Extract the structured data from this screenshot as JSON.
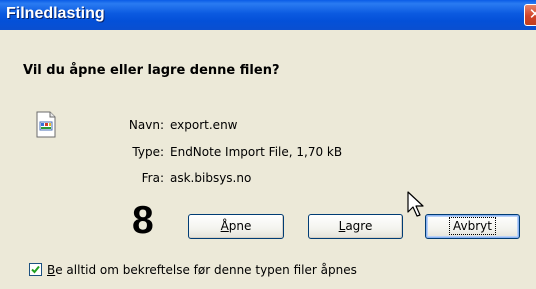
{
  "window": {
    "title": "Filnedlasting",
    "close_glyph": "✕"
  },
  "dialog": {
    "question": "Vil du åpne eller lagre denne filen?",
    "file_icon": "file-document-icon",
    "fields": [
      {
        "label": "Navn:",
        "value": "export.enw"
      },
      {
        "label": "Type:",
        "value": "EndNote Import File, 1,70 kB"
      },
      {
        "label": "Fra:",
        "value": "ask.bibsys.no"
      }
    ]
  },
  "annotation": {
    "step_number": "8"
  },
  "buttons": {
    "open": {
      "mnemonic": "Å",
      "rest": "pne"
    },
    "save": {
      "mnemonic": "L",
      "rest": "agre"
    },
    "cancel": {
      "label": "Avbryt"
    }
  },
  "always_ask": {
    "checked": true,
    "mnemonic": "B",
    "rest": "e alltid om bekreftelse før denne typen filer åpnes"
  }
}
